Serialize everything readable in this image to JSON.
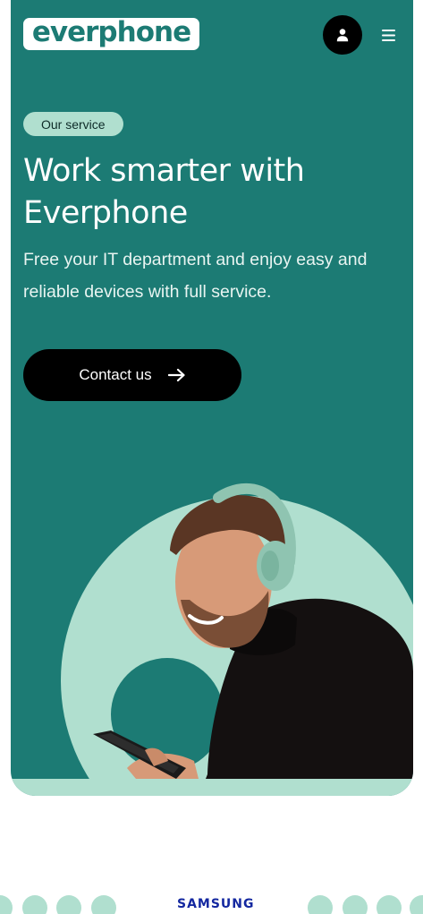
{
  "header": {
    "logo_text": "everphone",
    "account_icon": "user-icon",
    "menu_icon": "hamburger-menu-icon"
  },
  "hero": {
    "badge": "Our service",
    "title_line1": "Work smarter with",
    "title_line2": "Everphone",
    "subtitle_line1": "Free your IT department and enjoy easy and",
    "subtitle_line2": "reliable devices with full service.",
    "cta_label": "Contact us",
    "cta_icon": "arrow-right-icon"
  },
  "brands": {
    "visible_brand": "SAMSUNG"
  },
  "colors": {
    "primary": "#1c7b74",
    "accent": "#b0dfcf",
    "cta": "#000000",
    "brand_blue": "#1428a0"
  }
}
